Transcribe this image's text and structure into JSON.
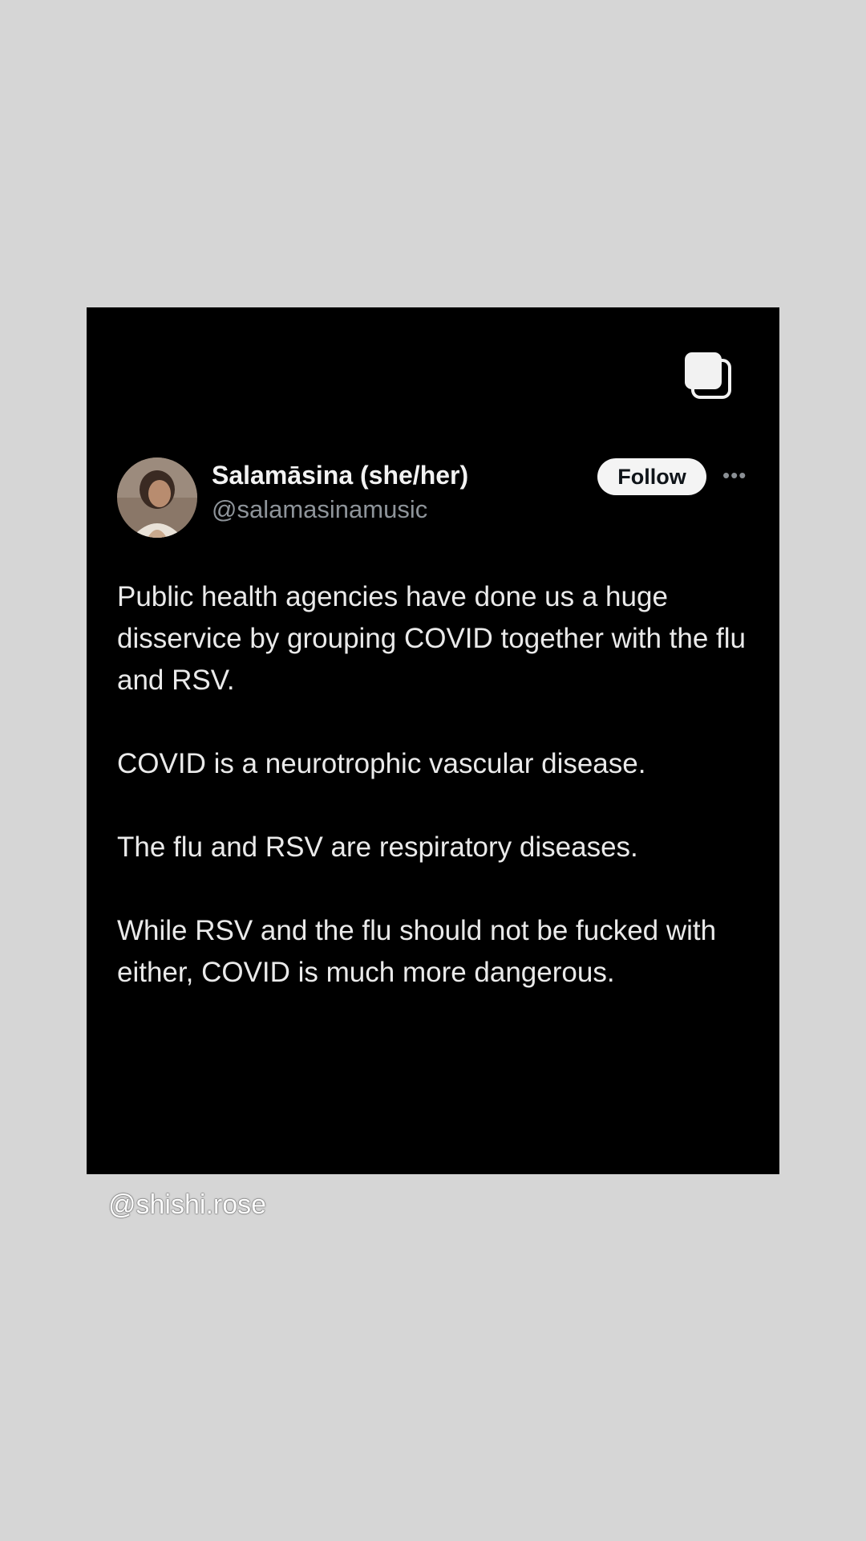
{
  "post": {
    "display_name": "Salamāsina (she/her)",
    "handle": "@salamasinamusic",
    "follow_label": "Follow",
    "more_icon": "more-icon",
    "multi_post_icon": "multiple-posts-icon",
    "paragraphs": [
      "Public health agencies have done us a huge disservice by grouping COVID together with the flu and RSV.",
      "COVID is a neurotrophic vascular disease.",
      "The flu and RSV are respiratory diseases.",
      "While RSV and the flu should not be fucked with either, COVID is much more dangerous."
    ]
  },
  "watermark": {
    "text": "@shishi.rose"
  },
  "colors": {
    "page_background": "#d6d6d6",
    "card_background": "#000000",
    "handle_gray": "#8e949a",
    "follow_background": "#f4f4f4"
  }
}
